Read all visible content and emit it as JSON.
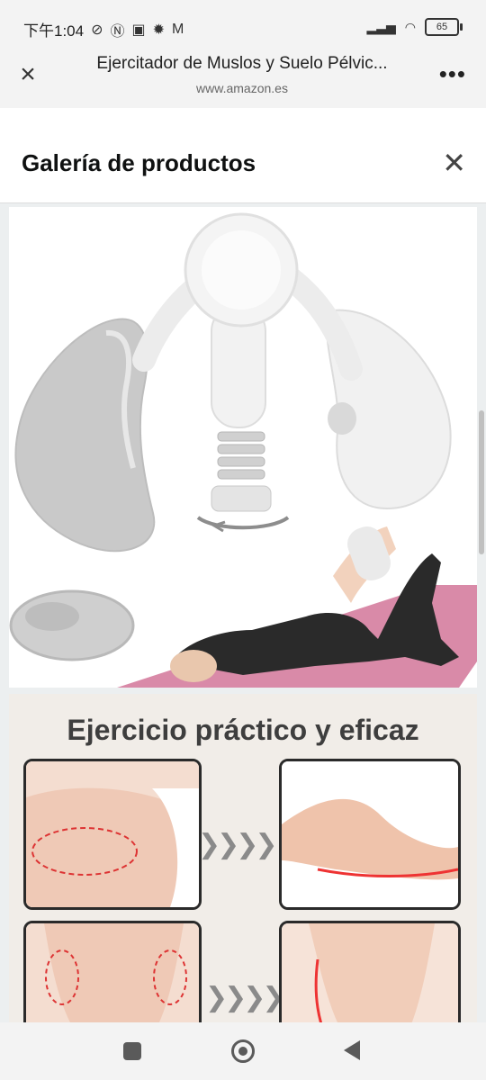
{
  "status_bar": {
    "time": "下午1:04",
    "icons": [
      "do-not-disturb-icon",
      "nfc-icon",
      "app-icon",
      "settings-gear-icon",
      "gmail-icon"
    ],
    "battery": "65"
  },
  "browser": {
    "title": "Ejercitador de Muslos y Suelo Pélvic...",
    "domain": "www.amazon.es"
  },
  "gallery": {
    "title": "Galería de productos"
  },
  "image2": {
    "headline": "Ejercicio práctico y eficaz"
  },
  "colors": {
    "status_bg": "#f3f3f3",
    "content_bg": "#eceff0",
    "mat_pink": "#d98aa8"
  }
}
